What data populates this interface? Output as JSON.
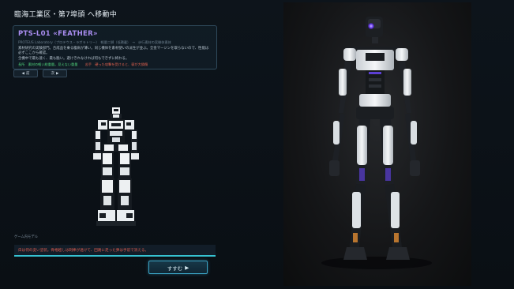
{
  "header": {
    "location": "臨海工業区・第7埠頭 へ移動中"
  },
  "unit": {
    "name": "PTS-L01 «FEATHER»",
    "meta": "PROTEUS Laboratory（プロテウス・ラボラトリー）　軽量二脚（低積載）　→　歩行素材の実験体素体",
    "description_1": "素材研究の実験部門。合成品を乗る腹肩が薄い。同じ機体を素材使いの派生が並ぶ。全金マージンを取らないので、性能は",
    "description_2": "必ずここから確認。",
    "description_3": "全機中で最も速く、最も脆い。避けきれなければ何もできずに終わる。",
    "trait_good": "長所　素材の軽い総重量。見えない重量",
    "trait_bad": "苦手　硬った攻撃を受けると、弱が大損傷"
  },
  "nav": {
    "prev_icon": "◀",
    "prev_label": "前",
    "next_icon": "▶",
    "next_label": "次"
  },
  "model_section": {
    "label": "ゲーム内モデル"
  },
  "dialogue": {
    "text": "白は何の変い塗装。骨格越しは刺棒が透けて、回路に走った弾は手前で消える。"
  },
  "proceed_button": {
    "label": "すすむ",
    "icon": "▶"
  },
  "colors": {
    "accent_cyan": "#36c2d1",
    "unit_name_purple": "#a98df0",
    "trait_good_green": "#4fd07a",
    "warning_red": "#e25e50",
    "robot_eye_purple": "#7b4dff"
  },
  "icons": {
    "game_model": "voxel-robot",
    "render": "humanoid-robot-render"
  }
}
